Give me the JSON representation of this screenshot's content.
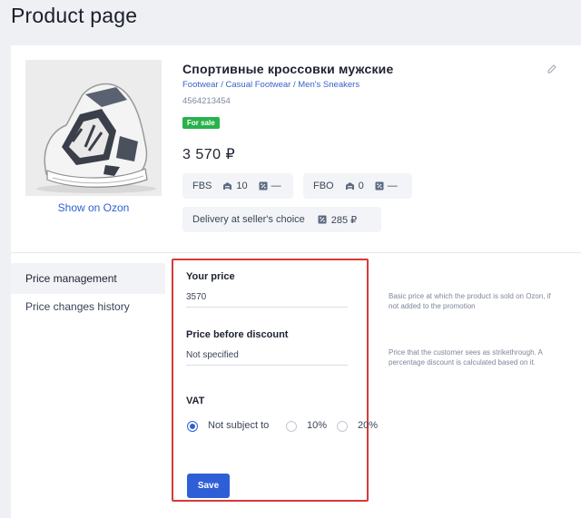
{
  "page": {
    "title": "Product page"
  },
  "product": {
    "name": "Спортивные кроссовки мужские",
    "breadcrumb": "Footwear / Casual Footwear / Men's Sneakers",
    "sku": "4564213454",
    "badge": "For sale",
    "price": "3 570 ₽",
    "show_link": "Show on Ozon",
    "image_icon": "sneaker-image"
  },
  "stock": {
    "fbs": {
      "label": "FBS",
      "warehouse": "10",
      "other": "—"
    },
    "fbo": {
      "label": "FBO",
      "warehouse": "0",
      "other": "—"
    },
    "delivery": {
      "label": "Delivery at seller's choice",
      "value": "285 ₽"
    }
  },
  "sidebar": {
    "items": [
      {
        "label": "Price management",
        "active": true
      },
      {
        "label": "Price changes history",
        "active": false
      }
    ]
  },
  "form": {
    "your_price": {
      "label": "Your price",
      "value": "3570",
      "help": "Basic price at which the product is sold on Ozon, if not added to the promotion"
    },
    "price_before": {
      "label": "Price before discount",
      "value": "Not specified",
      "help": "Price that the customer sees as strikethrough. A percentage discount is calculated based on it."
    },
    "vat": {
      "label": "VAT",
      "options": [
        "Not subject to",
        "10%",
        "20%"
      ],
      "selected": "Not subject to"
    },
    "save_label": "Save"
  },
  "colors": {
    "accent": "#2f5fd6",
    "badge": "#27b24a",
    "highlight_border": "#d63a3a"
  }
}
